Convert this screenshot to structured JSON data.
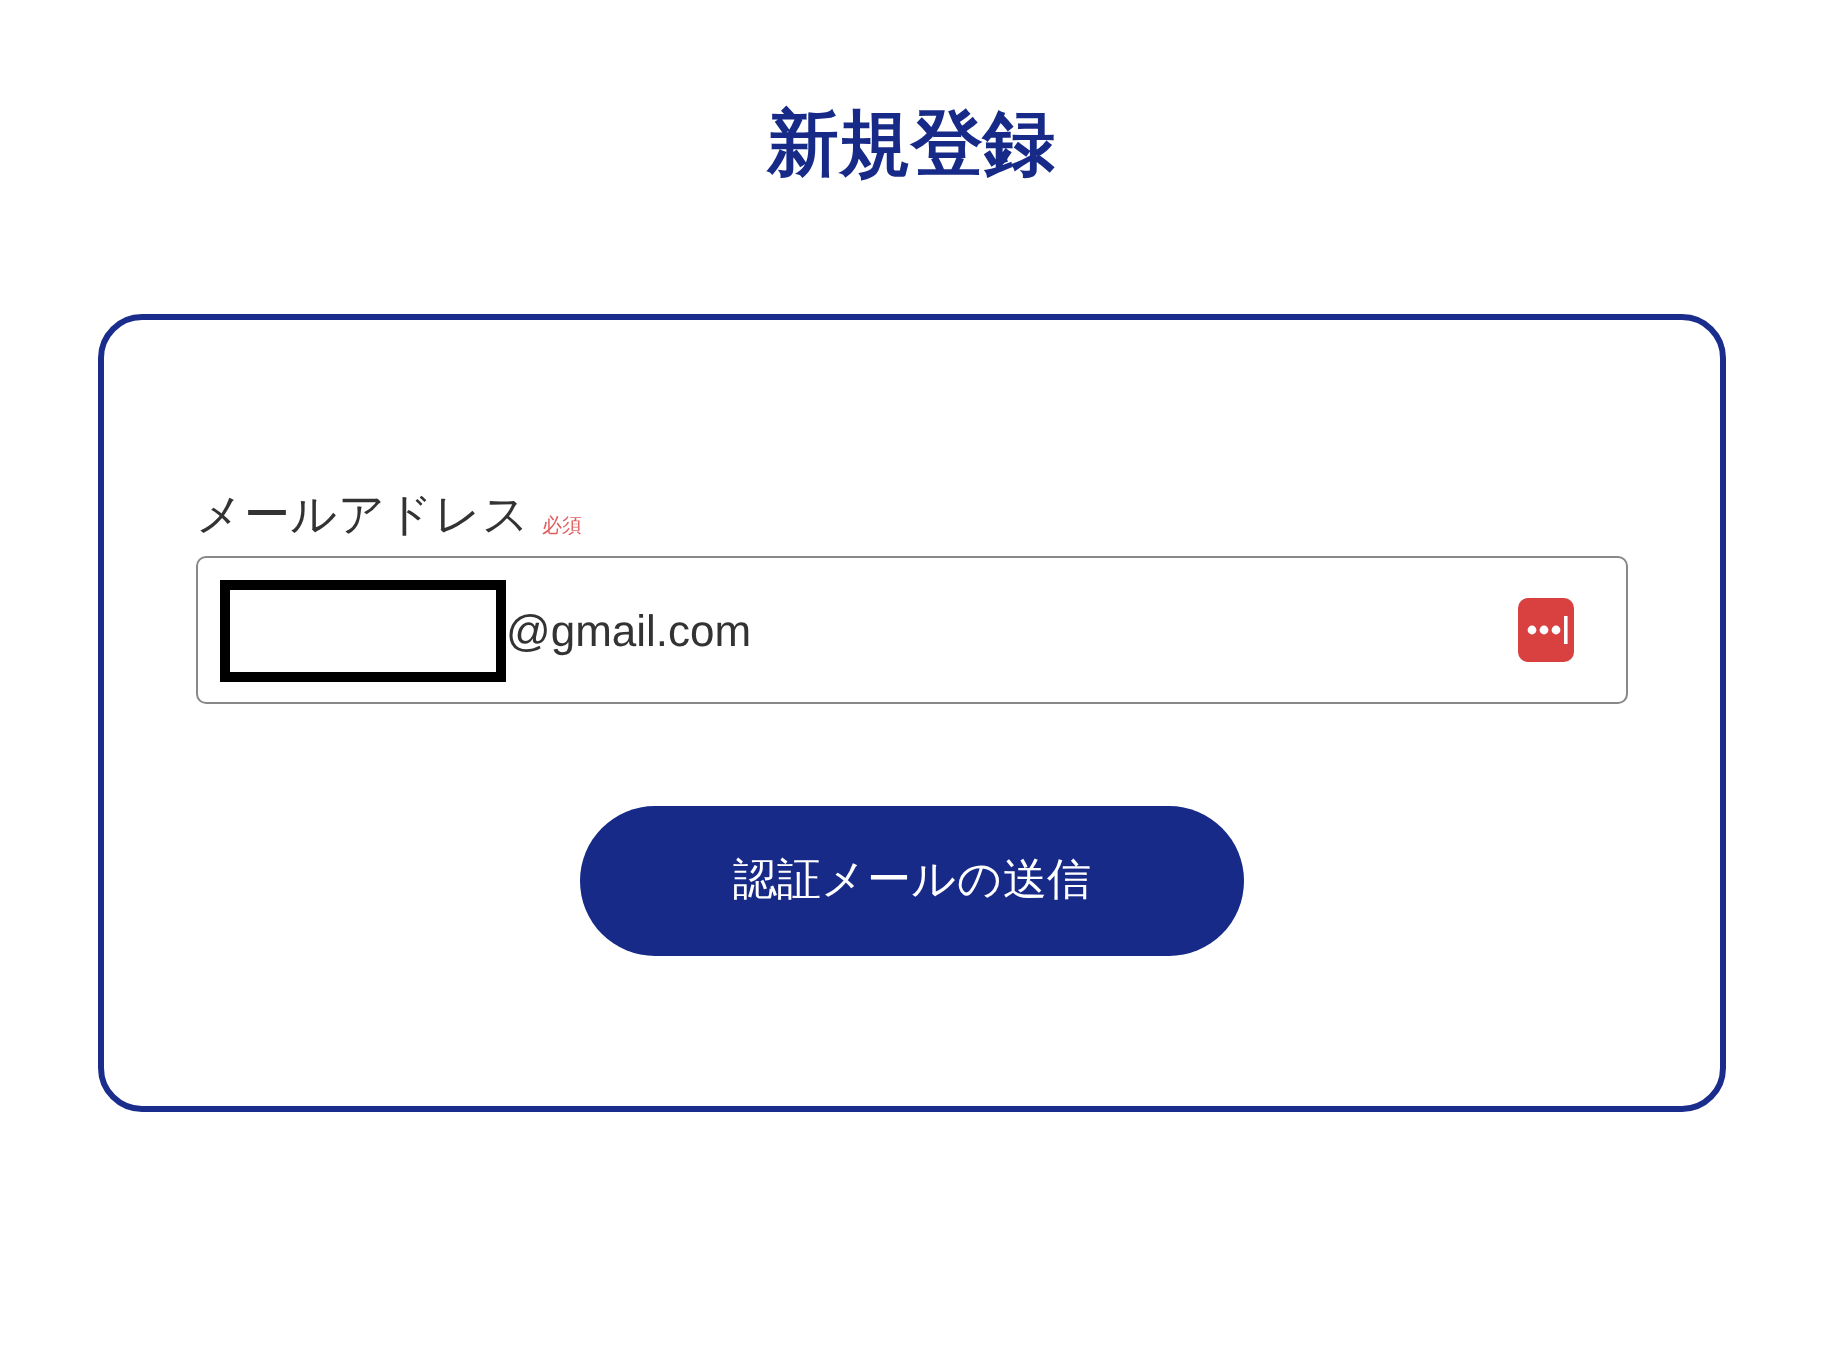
{
  "page": {
    "title": "新規登録"
  },
  "form": {
    "email": {
      "label": "メールアドレス",
      "required_badge": "必須",
      "value": "@gmail.com",
      "redacted": true
    },
    "submit_button": "認証メールの送信"
  }
}
